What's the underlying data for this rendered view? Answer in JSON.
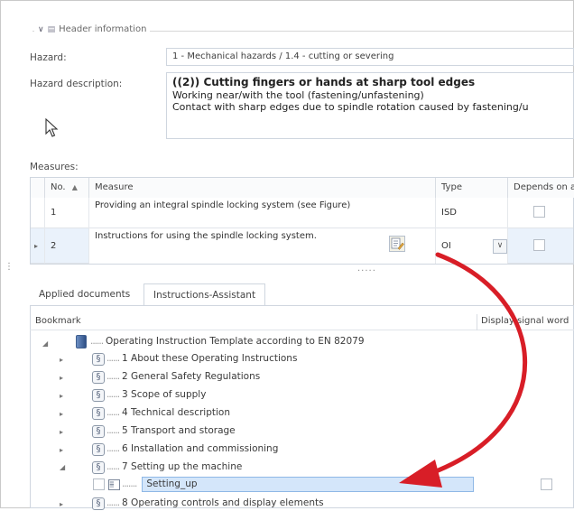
{
  "header": {
    "title": "Header information"
  },
  "hazard": {
    "label": "Hazard:",
    "value": "1 - Mechanical hazards / 1.4 - cutting or severing"
  },
  "hazard_description": {
    "label": "Hazard description:",
    "line1": "((2)) Cutting fingers or hands at sharp tool edges",
    "line2": "Working near/with the tool (fastening/unfastening)",
    "line3": "Contact with sharp edges due to spindle rotation caused by fastening/u"
  },
  "measures": {
    "label": "Measures:",
    "columns": {
      "no": "No.",
      "measure": "Measure",
      "type": "Type",
      "depends": "Depends on a co"
    },
    "rows": [
      {
        "no": "1",
        "measure": "Providing an integral spindle locking system (see Figure)",
        "type": "ISD"
      },
      {
        "no": "2",
        "measure": "Instructions for using the spindle locking system.",
        "type": "OI"
      }
    ],
    "splitter": "....."
  },
  "tabs": [
    {
      "label": "Applied documents"
    },
    {
      "label": "Instructions-Assistant"
    }
  ],
  "tree": {
    "col_bookmark": "Bookmark",
    "col_display": "Display signal word",
    "root": "Operating Instruction Template according to EN 82079",
    "items": [
      {
        "label": "1 About these Operating Instructions"
      },
      {
        "label": "2 General Safety Regulations"
      },
      {
        "label": "3 Scope of supply"
      },
      {
        "label": "4 Technical description"
      },
      {
        "label": "5 Transport and storage"
      },
      {
        "label": "6 Installation and commissioning"
      },
      {
        "label": "7 Setting up the machine"
      },
      {
        "label": "Setting_up"
      },
      {
        "label": "8 Operating controls and display elements"
      }
    ]
  },
  "colors": {
    "selection": "#d4e6fa",
    "arrow": "#d81e27",
    "border": "#cfd6df"
  }
}
